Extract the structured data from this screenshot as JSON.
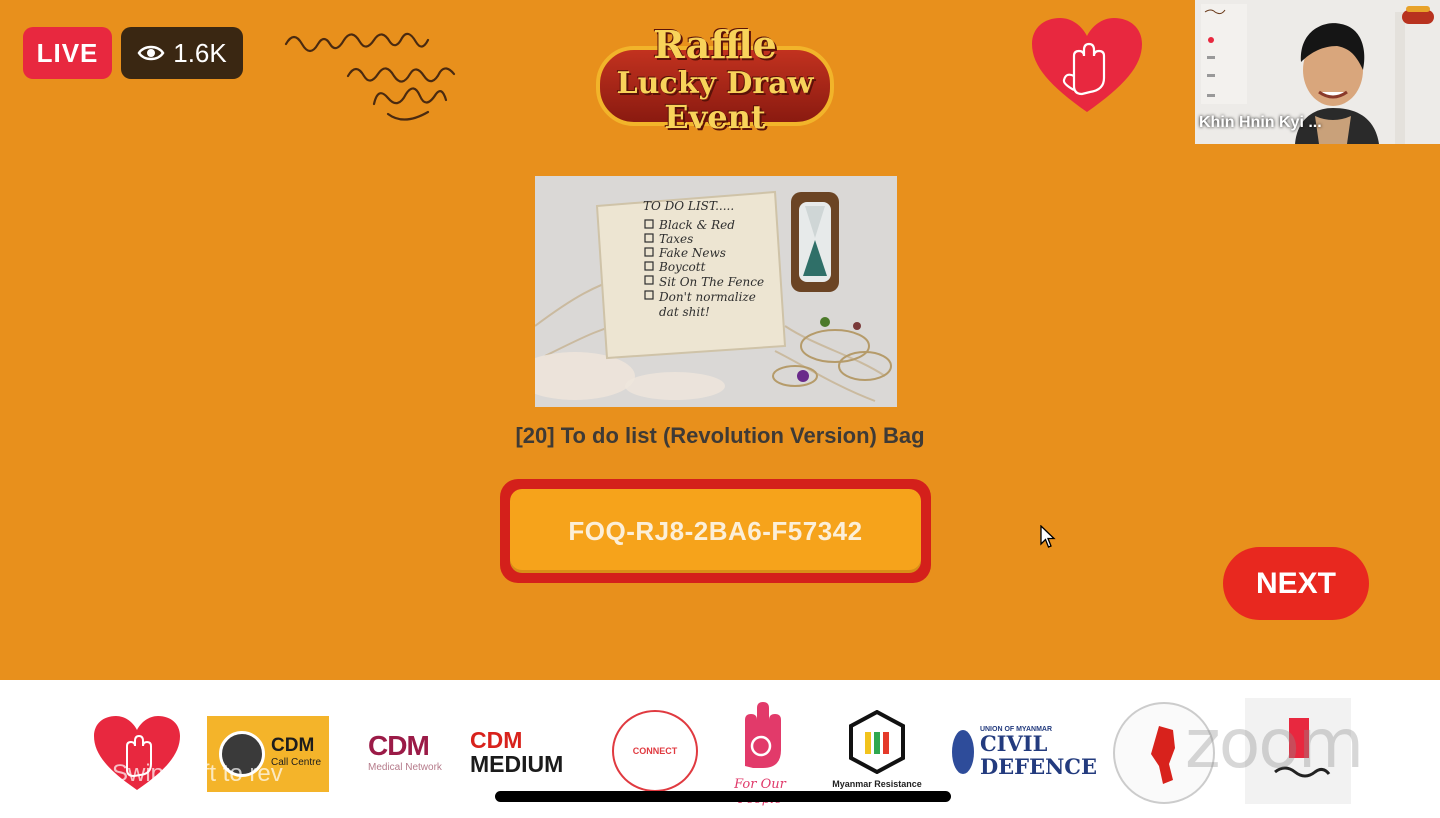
{
  "stream": {
    "live_label": "LIVE",
    "viewer_count": "1.6K"
  },
  "header": {
    "script_logo_text": "မုံရွာဂုဏ်ဆောင်လူငယ်များ",
    "raffle_logo": {
      "line1": "Raffle",
      "line2": "Lucky Draw",
      "line3": "Event"
    }
  },
  "webcam": {
    "participant_name": "Khin Hnin Kyi ..."
  },
  "prize": {
    "image_lines": [
      "TO DO LIST.....",
      "Black & Red",
      "Taxes",
      "Fake News",
      "Boycott",
      "Sit On The Fence",
      "Don't normalize",
      "dat shit!"
    ],
    "title": "[20] To do list (Revolution Version) Bag",
    "code": "FOQ-RJ8-2BA6-F57342"
  },
  "controls": {
    "next_label": "NEXT"
  },
  "sponsors": {
    "cdm_call_centre": {
      "title": "CDM",
      "subtitle": "Call Centre"
    },
    "cdm_medical": {
      "title": "CDM",
      "subtitle": "Medical Network"
    },
    "cdm_medium": {
      "line1": "CDM",
      "line2": "MEDIUM"
    },
    "connect": "CONNECT",
    "for_our_people": "For Our People",
    "myanmar_resistance": "Myanmar Resistance",
    "civil_defence": {
      "union": "UNION OF MYANMAR",
      "title": "CIVIL",
      "title2": "DEFENCE"
    }
  },
  "overlay": {
    "swipe_hint": "Swipe left to rev",
    "zoom_watermark": "zoom"
  },
  "colors": {
    "background": "#E8901C",
    "live_red": "#E8283F",
    "code_frame": "#D4201B",
    "code_fill": "#F6A31B",
    "next_button": "#E8281F"
  }
}
